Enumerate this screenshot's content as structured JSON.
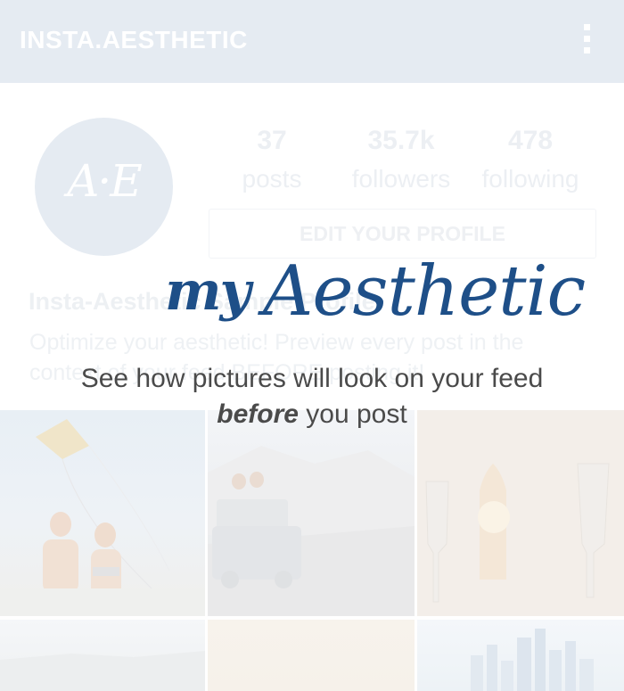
{
  "appbar": {
    "title": "INSTA.AESTHETIC",
    "menu_icon": "more-vert-icon"
  },
  "profile": {
    "avatar_monogram": "A·E",
    "stats": [
      {
        "value": "37",
        "label": "posts"
      },
      {
        "value": "35.7k",
        "label": "followers"
      },
      {
        "value": "478",
        "label": "following"
      }
    ],
    "edit_button": "EDIT YOUR PROFILE",
    "name": "Insta-Aesthetic Sample Profile",
    "bio": "Optimize your aesthetic! Preview every post in the context of your feed BEFORE posting it!"
  },
  "overlay": {
    "logo_my": "my",
    "logo_aesthetic": "Aesthetic",
    "tagline_line1": "See how pictures will look on your feed",
    "tagline_emphasis": "before",
    "tagline_rest": "you post"
  },
  "colors": {
    "appbar": "#e5ebf2",
    "brand": "#1e4f88",
    "tagline": "#4a4a4a"
  }
}
